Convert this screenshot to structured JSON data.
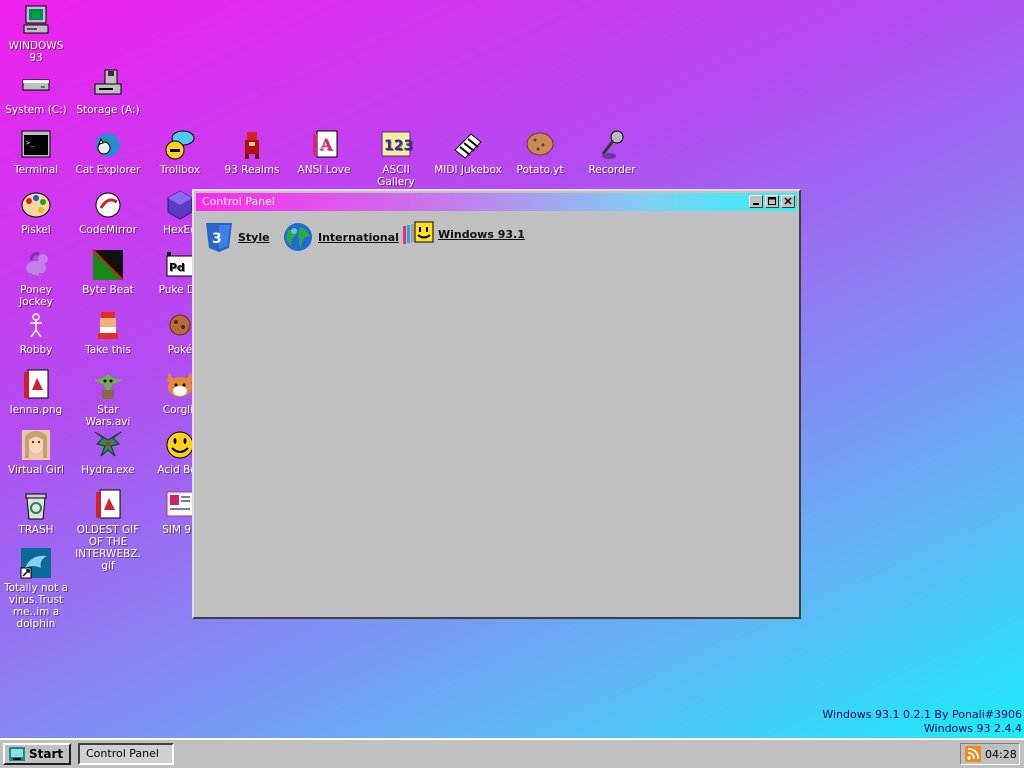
{
  "desktop": {
    "icons": [
      {
        "label": "WINDOWS 93",
        "icon": "computer-icon"
      },
      {
        "label": "System (C:)",
        "icon": "hard-drive-icon"
      },
      {
        "label": "Storage (A:)",
        "icon": "floppy-drive-icon"
      },
      {
        "label": "Terminal",
        "icon": "terminal-icon"
      },
      {
        "label": "Cat Explorer",
        "icon": "cat-explorer-icon"
      },
      {
        "label": "Trollbox",
        "icon": "trollbox-icon"
      },
      {
        "label": "93 Realms",
        "icon": "realms-icon"
      },
      {
        "label": "ANSI Love",
        "icon": "ansi-love-icon"
      },
      {
        "label": "ASCII Gallery",
        "icon": "ascii-gallery-icon"
      },
      {
        "label": "MIDI Jukebox",
        "icon": "midi-jukebox-icon"
      },
      {
        "label": "Potato.yt",
        "icon": "potato-icon"
      },
      {
        "label": "Recorder",
        "icon": "microphone-icon"
      },
      {
        "label": "Piskel",
        "icon": "palette-icon"
      },
      {
        "label": "CodeMirror",
        "icon": "codemirror-icon"
      },
      {
        "label": "HexEd",
        "icon": "hexed-icon"
      },
      {
        "label": "Poney Jockey",
        "icon": "pony-icon"
      },
      {
        "label": "Byte Beat",
        "icon": "bytebeat-icon"
      },
      {
        "label": "Puke Da",
        "icon": "puredata-icon"
      },
      {
        "label": "Robby",
        "icon": "robby-icon"
      },
      {
        "label": "Take this",
        "icon": "take-this-icon"
      },
      {
        "label": "Poké",
        "icon": "pokemon-icon"
      },
      {
        "label": "lenna.png",
        "icon": "image-file-icon"
      },
      {
        "label": "Star Wars.avi",
        "icon": "yoda-icon"
      },
      {
        "label": "Corglit",
        "icon": "corgi-icon"
      },
      {
        "label": "Virtual Girl",
        "icon": "virtual-girl-icon"
      },
      {
        "label": "Hydra.exe",
        "icon": "hydra-icon"
      },
      {
        "label": "Acid Box",
        "icon": "acid-smiley-icon"
      },
      {
        "label": "TRASH",
        "icon": "trash-icon"
      },
      {
        "label": "OLDEST GIF OF THE INTERWEBZ.gif",
        "icon": "gif-file-icon"
      },
      {
        "label": "SIM 93",
        "icon": "sim93-icon"
      },
      {
        "label": "Totally not a virus.Trust me..im a dolphin",
        "icon": "dolphin-shortcut-icon"
      }
    ]
  },
  "window": {
    "title": "Control Panel",
    "items": [
      {
        "label": "Style",
        "icon": "css3-icon"
      },
      {
        "label": "International",
        "icon": "globe-icon"
      },
      {
        "label": "Windows 93.1",
        "icon": "windows93-smiley-icon"
      }
    ]
  },
  "version": {
    "line1": "Windows 93.1 0.2.1 By Ponali#3906",
    "line2": "Windows 93 2.4.4"
  },
  "taskbar": {
    "start_label": "Start",
    "task_label": "Control Panel",
    "clock": "04:28",
    "tray_icon": "rss-icon"
  }
}
